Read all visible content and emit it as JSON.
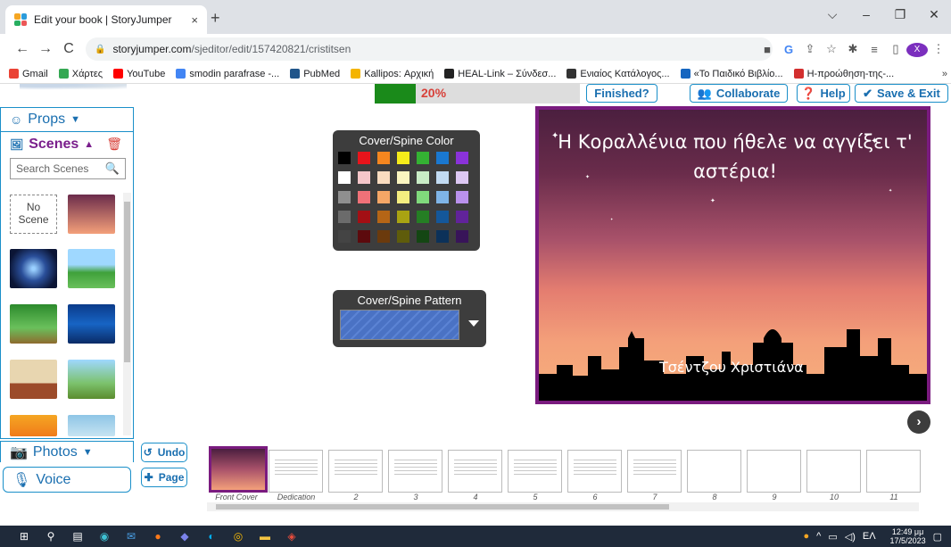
{
  "browser": {
    "tab_title": "Edit your book | StoryJumper",
    "tab_close": "×",
    "new_tab": "+",
    "window_controls": [
      "⌵",
      "–",
      "❐",
      "✕"
    ],
    "nav": {
      "back": "←",
      "forward": "→",
      "reload": "C"
    },
    "url_host": "storyjumper.com",
    "url_path": "/sjeditor/edit/157420821/cristitsen",
    "avatar_letter": "X",
    "bookmarks": [
      {
        "label": "Gmail",
        "color": "#ea4335"
      },
      {
        "label": "Χάρτες",
        "color": "#34a853"
      },
      {
        "label": "YouTube",
        "color": "#ff0000"
      },
      {
        "label": "smodin parafrase -...",
        "color": "#4285f4"
      },
      {
        "label": "PubMed",
        "color": "#20558a"
      },
      {
        "label": "Kallipos: Αρχική",
        "color": "#f4b400"
      },
      {
        "label": "HEAL-Link – Σύνδεσ...",
        "color": "#222222"
      },
      {
        "label": "Ενιαίος Κατάλογος...",
        "color": "#333333"
      },
      {
        "label": "«Το Παιδικό Βιβλίο...",
        "color": "#1565c0"
      },
      {
        "label": "Η-προώθηση-της-...",
        "color": "#d32f2f"
      }
    ],
    "bookmarks_more": "»"
  },
  "editor": {
    "progress": {
      "percent": 20,
      "label": "20%"
    },
    "buttons": {
      "finished": "Finished?",
      "collaborate": "Collaborate",
      "help": "Help",
      "save_exit": "Save & Exit"
    },
    "left": {
      "props": "Props",
      "scenes": "Scenes",
      "search_placeholder": "Search Scenes",
      "no_scene": "No Scene",
      "photos": "Photos",
      "voice": "Voice"
    },
    "undo": "Undo",
    "page": "Page",
    "color_panel_title": "Cover/Spine Color",
    "pattern_panel_title": "Cover/Spine Pattern",
    "swatch_colors": [
      "#000000",
      "#e8141b",
      "#f5861f",
      "#f6ec1a",
      "#34b233",
      "#1a78d0",
      "#8a32d9",
      "#ffffff",
      "#f5c6c9",
      "#f9dcc0",
      "#faf5c0",
      "#c9ecc6",
      "#c2dbf2",
      "#ddc8f3",
      "#8f8f8f",
      "#f07178",
      "#f5a666",
      "#f5ee80",
      "#80d97c",
      "#7fb4e6",
      "#b991ec",
      "#6b6b6b",
      "#a30f14",
      "#b56516",
      "#a9a312",
      "#257e24",
      "#14579a",
      "#61239a",
      "#444444",
      "#5c0a0d",
      "#6b3a0d",
      "#5f5c0b",
      "#144613",
      "#0c3159",
      "#381459"
    ],
    "cover": {
      "title": "Η Κοραλλένια που ήθελε να αγγίξει τ' αστέρια!",
      "author": "Τσέντζου Χριστιάνα"
    },
    "filmstrip": [
      {
        "label": "Front Cover"
      },
      {
        "label": "Dedication Page"
      },
      {
        "label": "2"
      },
      {
        "label": "3"
      },
      {
        "label": "4"
      },
      {
        "label": "5"
      },
      {
        "label": "6"
      },
      {
        "label": "7"
      },
      {
        "label": "8"
      },
      {
        "label": "9"
      },
      {
        "label": "10"
      },
      {
        "label": "11"
      }
    ]
  },
  "taskbar": {
    "lang": "ΕΛ",
    "time": "12:49 μμ",
    "date": "17/5/2023"
  }
}
